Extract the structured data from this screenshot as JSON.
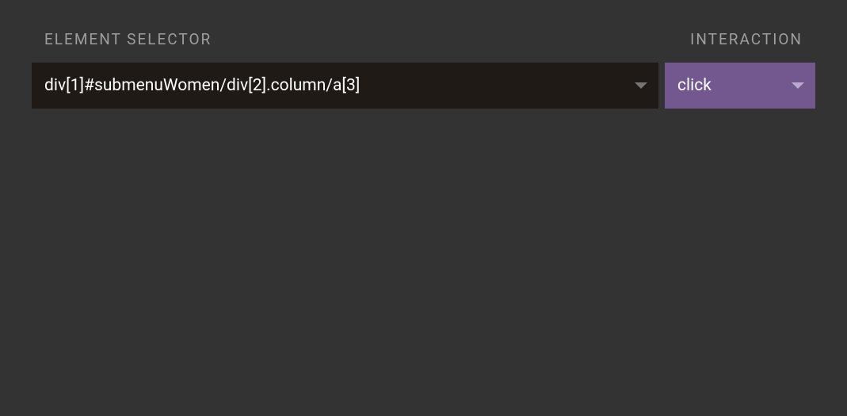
{
  "labels": {
    "element_selector": "ELEMENT SELECTOR",
    "interaction": "INTERACTION"
  },
  "fields": {
    "selector_value": "div[1]#submenuWomen/div[2].column/a[3]",
    "interaction_value": "click"
  }
}
